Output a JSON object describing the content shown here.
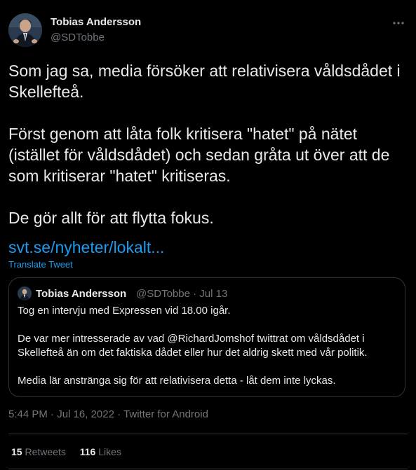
{
  "author": {
    "name": "Tobias Andersson",
    "handle": "@SDTobbe"
  },
  "more_icon": "more-horizontal-icon",
  "tweet": {
    "paragraphs": [
      "Som jag sa, media försöker att relativisera våldsdådet i Skellefteå.",
      "Först genom att låta folk kritisera \"hatet\" på nätet (istället för våldsdådet) och sedan gråta ut över att de som kritiserar \"hatet\" kritiseras.",
      "De gör allt för att flytta fokus."
    ],
    "link": "svt.se/nyheter/lokalt...",
    "translate": "Translate Tweet"
  },
  "quote": {
    "name": "Tobias Andersson",
    "handle": "@SDTobbe",
    "sep": "·",
    "date": "Jul 13",
    "paragraphs": [
      "Tog en intervju med Expressen vid 18.00 igår.",
      "De var mer intresserade av vad @RichardJomshof twittrat om våldsdådet i Skellefteå än om det faktiska dådet eller hur det aldrig skett med vår politik.",
      "Media lär anstränga sig för att relativisera detta - låt dem inte lyckas."
    ]
  },
  "meta": {
    "time": "5:44 PM",
    "sep": "·",
    "date": "Jul 16, 2022",
    "source": "Twitter for Android"
  },
  "stats": {
    "retweets_count": "15",
    "retweets_label": "Retweets",
    "likes_count": "116",
    "likes_label": "Likes"
  },
  "colors": {
    "background": "#000000",
    "text": "#e7e9ea",
    "muted": "#71767b",
    "link": "#1d9bf0",
    "border": "#2f3336"
  }
}
